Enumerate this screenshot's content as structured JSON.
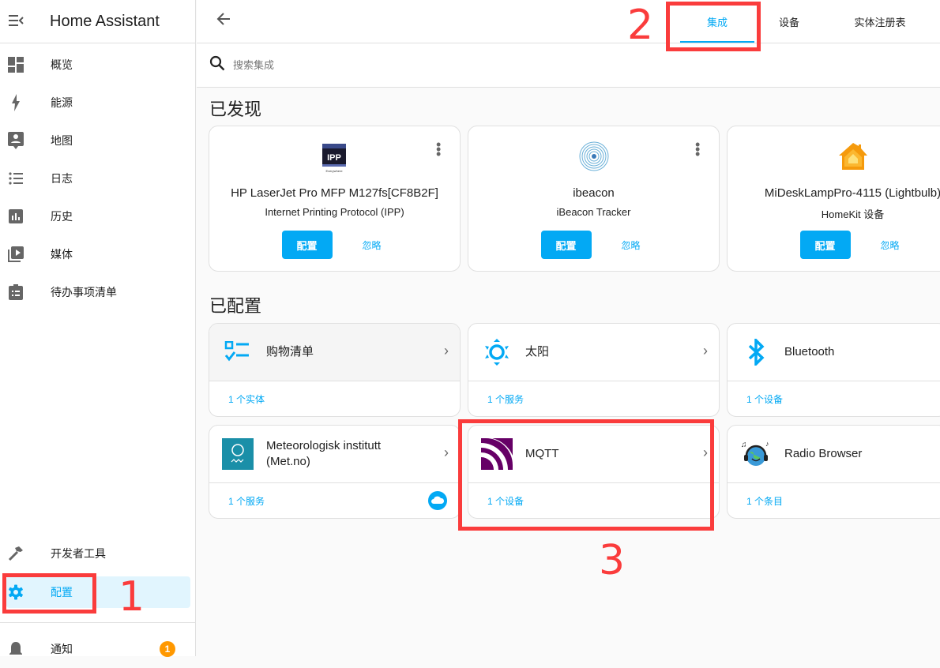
{
  "app_title": "Home Assistant",
  "sidebar": {
    "items": [
      {
        "label": "概览",
        "icon": "dashboard-icon"
      },
      {
        "label": "能源",
        "icon": "lightning-icon"
      },
      {
        "label": "地图",
        "icon": "map-person-icon"
      },
      {
        "label": "日志",
        "icon": "list-icon"
      },
      {
        "label": "历史",
        "icon": "chart-bar-icon"
      },
      {
        "label": "媒体",
        "icon": "play-box-icon"
      },
      {
        "label": "待办事项清单",
        "icon": "clipboard-list-icon"
      }
    ],
    "bottom": [
      {
        "label": "开发者工具",
        "icon": "hammer-icon"
      },
      {
        "label": "配置",
        "icon": "gear-icon",
        "selected": true
      },
      {
        "label": "通知",
        "icon": "bell-icon",
        "badge": "1"
      }
    ]
  },
  "tabs": [
    {
      "label": "集成",
      "active": true
    },
    {
      "label": "设备"
    },
    {
      "label": "实体注册表"
    }
  ],
  "search": {
    "placeholder": "搜索集成"
  },
  "discovered": {
    "title": "已发现",
    "configure_label": "配置",
    "ignore_label": "忽略",
    "cards": [
      {
        "name": "HP LaserJet Pro MFP M127fs[CF8B2F]",
        "integration": "Internet Printing Protocol (IPP)",
        "icon": "ipp-logo"
      },
      {
        "name": "ibeacon",
        "integration": "iBeacon Tracker",
        "icon": "ibeacon-logo"
      },
      {
        "name": "MiDeskLampPro-4115 (Lightbulb)",
        "integration": "HomeKit 设备",
        "icon": "homekit-logo"
      }
    ]
  },
  "configured": {
    "title": "已配置",
    "cards": [
      {
        "name": "购物清单",
        "count": "1 个实体",
        "icon": "shopping-list-icon"
      },
      {
        "name": "太阳",
        "count": "1 个服务",
        "icon": "sun-icon"
      },
      {
        "name": "Bluetooth",
        "count": "1 个设备",
        "icon": "bluetooth-icon"
      },
      {
        "name": "Meteorologisk institutt (Met.no)",
        "count": "1 个服务",
        "icon": "met-no-logo",
        "cloud": true
      },
      {
        "name": "MQTT",
        "count": "1 个设备",
        "icon": "mqtt-logo"
      },
      {
        "name": "Radio Browser",
        "count": "1 个条目",
        "icon": "radio-browser-logo"
      }
    ]
  },
  "annotations": [
    "1",
    "2",
    "3"
  ],
  "colors": {
    "accent": "#03a9f4",
    "badge": "#ff9800",
    "annotation": "#fa3c3c",
    "selected_bg": "#e1f5fe"
  }
}
